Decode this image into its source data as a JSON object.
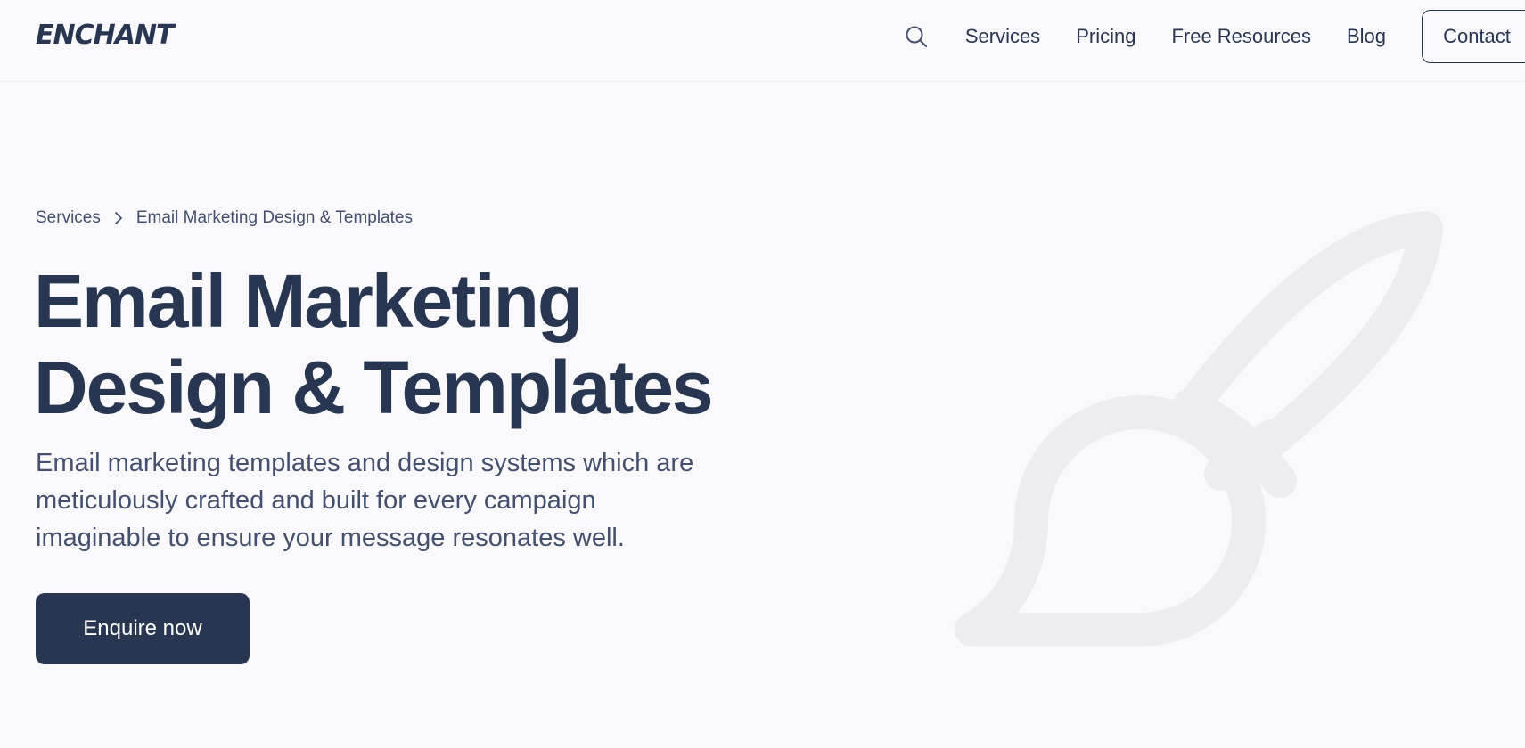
{
  "header": {
    "logo_text": "ENCHANT",
    "search_icon": "search-icon",
    "nav": [
      {
        "label": "Services"
      },
      {
        "label": "Pricing"
      },
      {
        "label": "Free Resources"
      },
      {
        "label": "Blog"
      }
    ],
    "contact_label": "Contact"
  },
  "breadcrumb": {
    "parent": "Services",
    "separator_icon": "chevron-right-icon",
    "current": "Email Marketing Design & Templates"
  },
  "hero": {
    "title_line1": "Email Marketing",
    "title_line2": "Design & Templates",
    "subtitle_line1": "Email marketing templates and design systems which are",
    "subtitle_line2": "meticulously crafted and built for every campaign",
    "subtitle_line3": "imaginable to ensure your message resonates well.",
    "cta_label": "Enquire now",
    "illustration_icon": "paintbrush-icon"
  },
  "colors": {
    "primary": "#293651",
    "text_muted": "#44506d",
    "background": "#f9f9fc",
    "illustration": "#ececf1"
  }
}
